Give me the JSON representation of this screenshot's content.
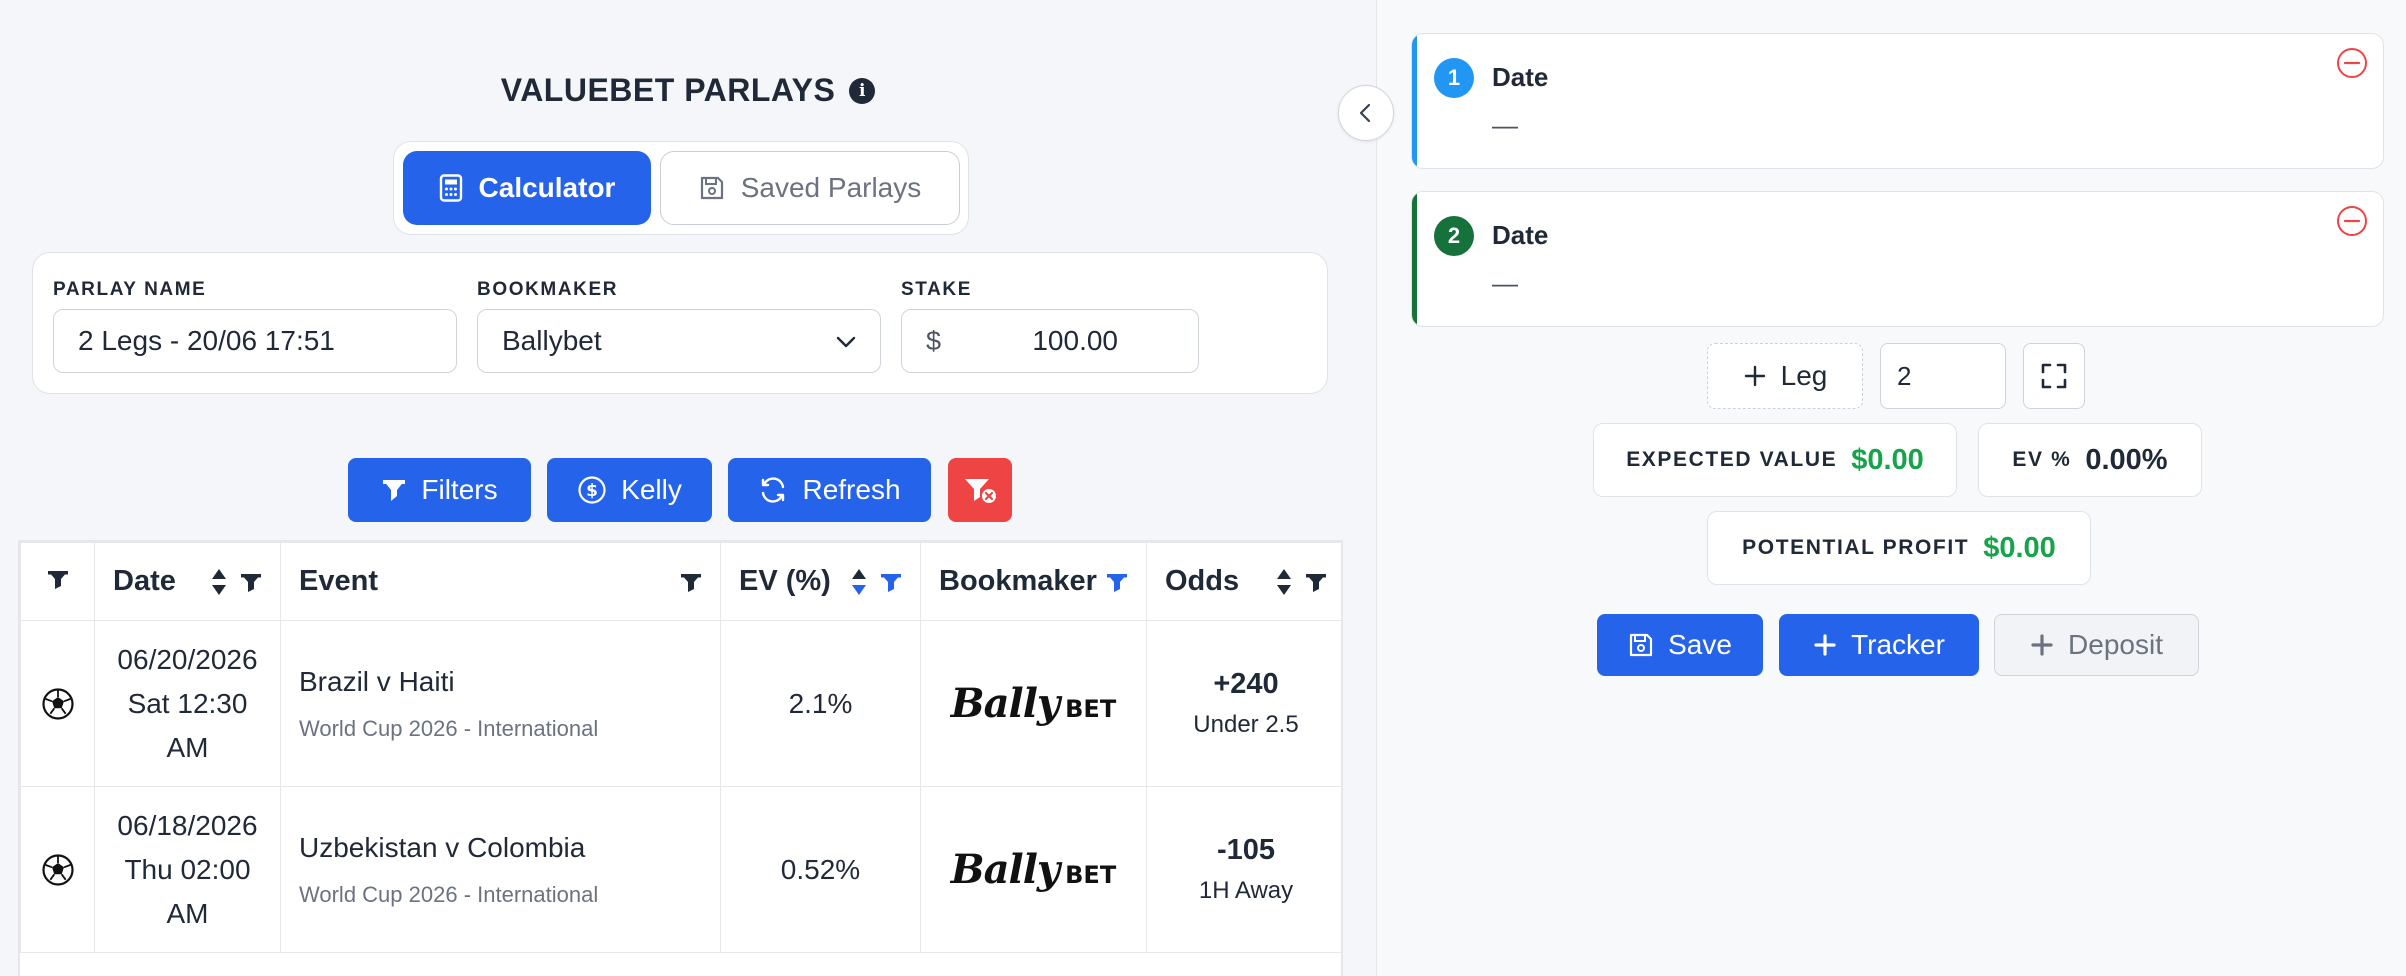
{
  "header": {
    "title": "VALUEBET PARLAYS",
    "info_glyph": "i"
  },
  "tabs": [
    {
      "label": "Calculator",
      "icon": "calculator-icon",
      "active": true
    },
    {
      "label": "Saved Parlays",
      "icon": "save-icon",
      "active": false
    }
  ],
  "form": {
    "parlay_name_label": "PARLAY NAME",
    "parlay_name_value": "2 Legs - 20/06 17:51",
    "bookmaker_label": "BOOKMAKER",
    "bookmaker_value": "Ballybet",
    "stake_label": "STAKE",
    "stake_currency": "$",
    "stake_value": "100.00"
  },
  "actions": {
    "filters": "Filters",
    "kelly": "Kelly",
    "refresh": "Refresh"
  },
  "table": {
    "columns": [
      "Date",
      "Event",
      "EV (%)",
      "Bookmaker",
      "Odds"
    ],
    "rows": [
      {
        "sport_icon": "soccer-ball-icon",
        "date_line1": "06/20/2026",
        "date_line2": "Sat 12:30",
        "date_line3": "AM",
        "event": "Brazil v Haiti",
        "league": "World Cup 2026 - International",
        "ev": "2.1%",
        "bookmaker_script": "Bally",
        "bookmaker_suffix": "BET",
        "odds": "+240",
        "market": "Under 2.5"
      },
      {
        "sport_icon": "soccer-ball-icon",
        "date_line1": "06/18/2026",
        "date_line2": "Thu 02:00",
        "date_line3": "AM",
        "event": "Uzbekistan v Colombia",
        "league": "World Cup 2026 - International",
        "ev": "0.52%",
        "bookmaker_script": "Bally",
        "bookmaker_suffix": "BET",
        "odds": "-105",
        "market": "1H Away"
      }
    ]
  },
  "legs": [
    {
      "number": "1",
      "title": "Date",
      "value": "—",
      "color": "#2196f3"
    },
    {
      "number": "2",
      "title": "Date",
      "value": "—",
      "color": "#16723a"
    }
  ],
  "leg_controls": {
    "add_leg_label": "Leg",
    "leg_count": "2"
  },
  "stats": {
    "expected_value_label": "EXPECTED VALUE",
    "expected_value": "$0.00",
    "ev_percent_label": "EV %",
    "ev_percent": "0.00%",
    "potential_profit_label": "POTENTIAL PROFIT",
    "potential_profit": "$0.00"
  },
  "bottom_buttons": {
    "save": "Save",
    "tracker": "Tracker",
    "deposit": "Deposit"
  },
  "colors": {
    "primary": "#2563eb",
    "danger": "#ef4444",
    "positive": "#16a34a",
    "sort_active": "#2563eb"
  }
}
